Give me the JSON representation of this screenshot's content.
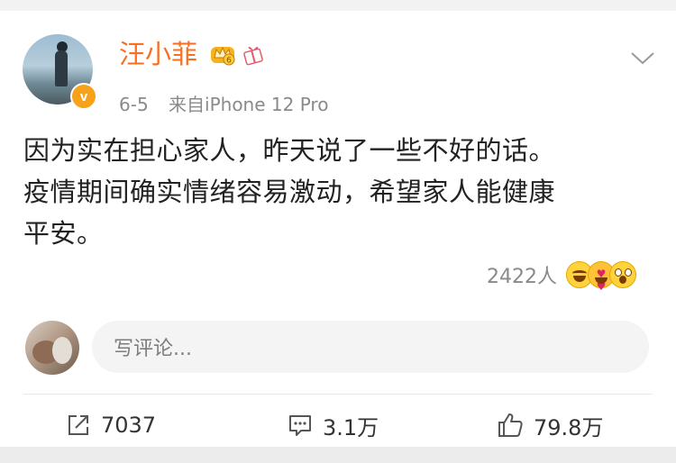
{
  "post": {
    "username": "汪小菲",
    "date": "6-5",
    "source": "来自iPhone 12 Pro",
    "verified_badge": "v",
    "content_lines": [
      "因为实在担心家人，昨天说了一些不好的话。",
      "疫情期间确实情绪容易激动，希望家人能健康",
      "平安。"
    ],
    "reaction_count": "2422人",
    "reaction_icons": [
      "grin-emoji",
      "heart-eyes-emoji",
      "shocked-emoji"
    ]
  },
  "comment": {
    "placeholder": "写评论..."
  },
  "actions": {
    "repost": "7037",
    "comments": "3.1万",
    "likes": "79.8万"
  },
  "colors": {
    "username": "#f86f21",
    "badge": "#f7a21b",
    "meta_text": "#8a8a8a",
    "content_text": "#222222",
    "background": "#f2f2f2"
  },
  "icons": {
    "crown": "crown-icon",
    "gift": "gift-icon",
    "chevron": "chevron-down-icon",
    "repost": "share-icon",
    "comment": "comment-icon",
    "like": "thumbs-up-icon"
  }
}
